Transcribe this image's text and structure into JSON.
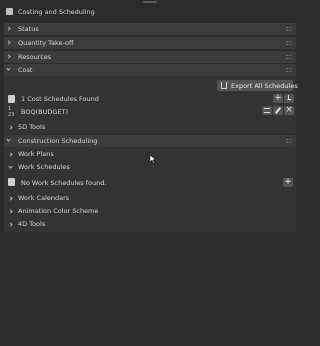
{
  "panel": {
    "title": "Costing and Scheduling"
  },
  "sections": {
    "status": "Status",
    "quantity_takeoff": "Quantity Take-off",
    "resources": "Resources",
    "cost": "Cost",
    "construction_scheduling": "Construction Scheduling"
  },
  "cost": {
    "export_button": "Export All Schedules",
    "found_text": "1 Cost Schedules Found",
    "schedule_name": "BOQ(BUDGET)",
    "five_d_tools": "5D Tools"
  },
  "scheduling": {
    "work_plans": "Work Plans",
    "work_schedules": "Work Schedules",
    "no_work_schedules": "No Work Schedules found.",
    "work_calendars": "Work Calendars",
    "animation_color_scheme": "Animation Color Scheme",
    "four_d_tools": "4D Tools"
  },
  "icons": {
    "add": "+",
    "import": "import-icon",
    "edit": "pencil-icon",
    "delete": "×"
  }
}
